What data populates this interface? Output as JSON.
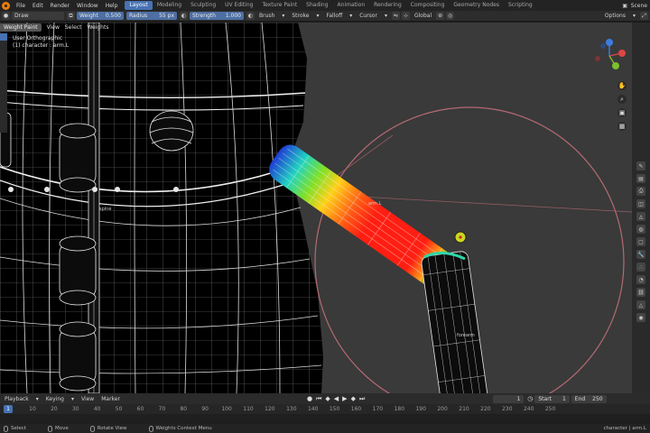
{
  "menu": {
    "items": [
      "File",
      "Edit",
      "Render",
      "Window",
      "Help"
    ]
  },
  "workspaces": {
    "active": "Layout",
    "tabs": [
      "Modeling",
      "Sculpting",
      "UV Editing",
      "Texture Paint",
      "Shading",
      "Animation",
      "Rendering",
      "Compositing",
      "Geometry Nodes",
      "Scripting"
    ]
  },
  "scene": {
    "label": "Scene"
  },
  "toolbar": {
    "brush_name": "Draw",
    "weight_label": "Weight",
    "weight_value": "0.500",
    "radius_label": "Radius",
    "radius_value": "55 px",
    "strength_label": "Strength",
    "strength_value": "1.000",
    "brush_dropdown": "Brush",
    "stroke_dropdown": "Stroke",
    "falloff_dropdown": "Falloff",
    "cursor_dropdown": "Cursor",
    "orientation": "Global",
    "options": "Options"
  },
  "viewport": {
    "mode": "Weight Paint",
    "menus": [
      "View",
      "Select",
      "Weights"
    ],
    "view_name": "User Orthographic",
    "object_name": "(1) character : arm.L",
    "bone_labels": [
      "spine",
      "arm.L",
      "forearm"
    ]
  },
  "timeline": {
    "playback": "Playback",
    "keying": "Keying",
    "view": "View",
    "marker": "Marker",
    "current_frame": "1",
    "start_label": "Start",
    "start_value": "1",
    "end_label": "End",
    "end_value": "250",
    "ruler_current": "1",
    "ruler_ticks": [
      "10",
      "20",
      "30",
      "40",
      "50",
      "60",
      "70",
      "80",
      "90",
      "100",
      "110",
      "120",
      "130",
      "140",
      "150",
      "160",
      "170",
      "180",
      "190",
      "200",
      "210",
      "220",
      "230",
      "240",
      "250"
    ]
  },
  "status": {
    "select": "Select",
    "move": "Move",
    "rotate": "Rotate View",
    "context": "Weights Context Menu",
    "right": "character | arm.L"
  },
  "colors": {
    "accent": "#4772b3",
    "viewport_bg": "#3a3a3a",
    "brush_circle": "#b56a72",
    "axis_x": "#e04545",
    "axis_y": "#7cbf2f",
    "axis_z": "#3c7de0"
  },
  "icons": [
    "blender-logo-icon",
    "play-icon",
    "jump-start-icon",
    "jump-end-icon",
    "keyframe-prev-icon",
    "keyframe-next-icon",
    "hand-icon",
    "zoom-icon",
    "camera-icon",
    "grid-icon",
    "mouse-icon"
  ]
}
